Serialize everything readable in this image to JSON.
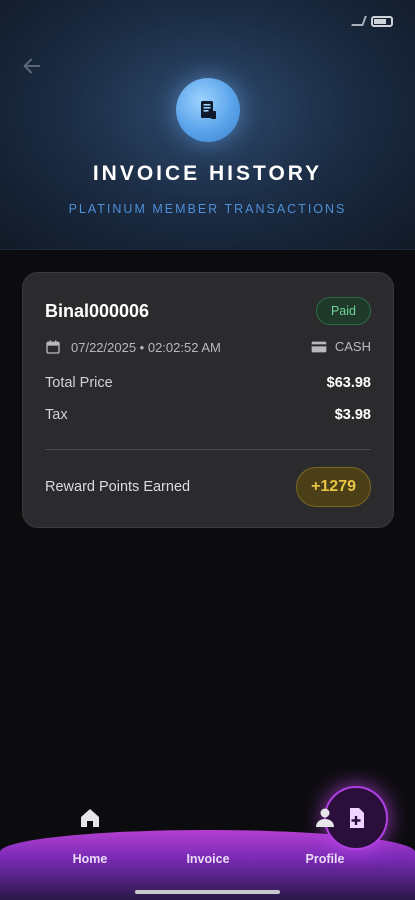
{
  "header": {
    "title": "INVOICE HISTORY",
    "subtitle": "PLATINUM MEMBER TRANSACTIONS"
  },
  "invoice": {
    "id": "Binal000006",
    "status": "Paid",
    "date": "07/22/2025 • 02:02:52 AM",
    "payment_method": "CASH",
    "total_price_label": "Total Price",
    "total_price": "$63.98",
    "tax_label": "Tax",
    "tax": "$3.98",
    "reward_label": "Reward Points Earned",
    "reward_points": "+1279"
  },
  "nav": {
    "home": "Home",
    "invoice": "Invoice",
    "profile": "Profile"
  },
  "icons": {
    "back": "arrow-left-icon",
    "header": "receipt-icon",
    "calendar": "calendar-icon",
    "card": "credit-card-icon",
    "home": "home-icon",
    "invoice": "add-document-icon",
    "profile": "person-icon"
  },
  "colors": {
    "accent_blue": "#4f8fd8",
    "paid_green": "#6fd39a",
    "reward_gold": "#e9c545",
    "nav_purple": "#b43fd0"
  }
}
